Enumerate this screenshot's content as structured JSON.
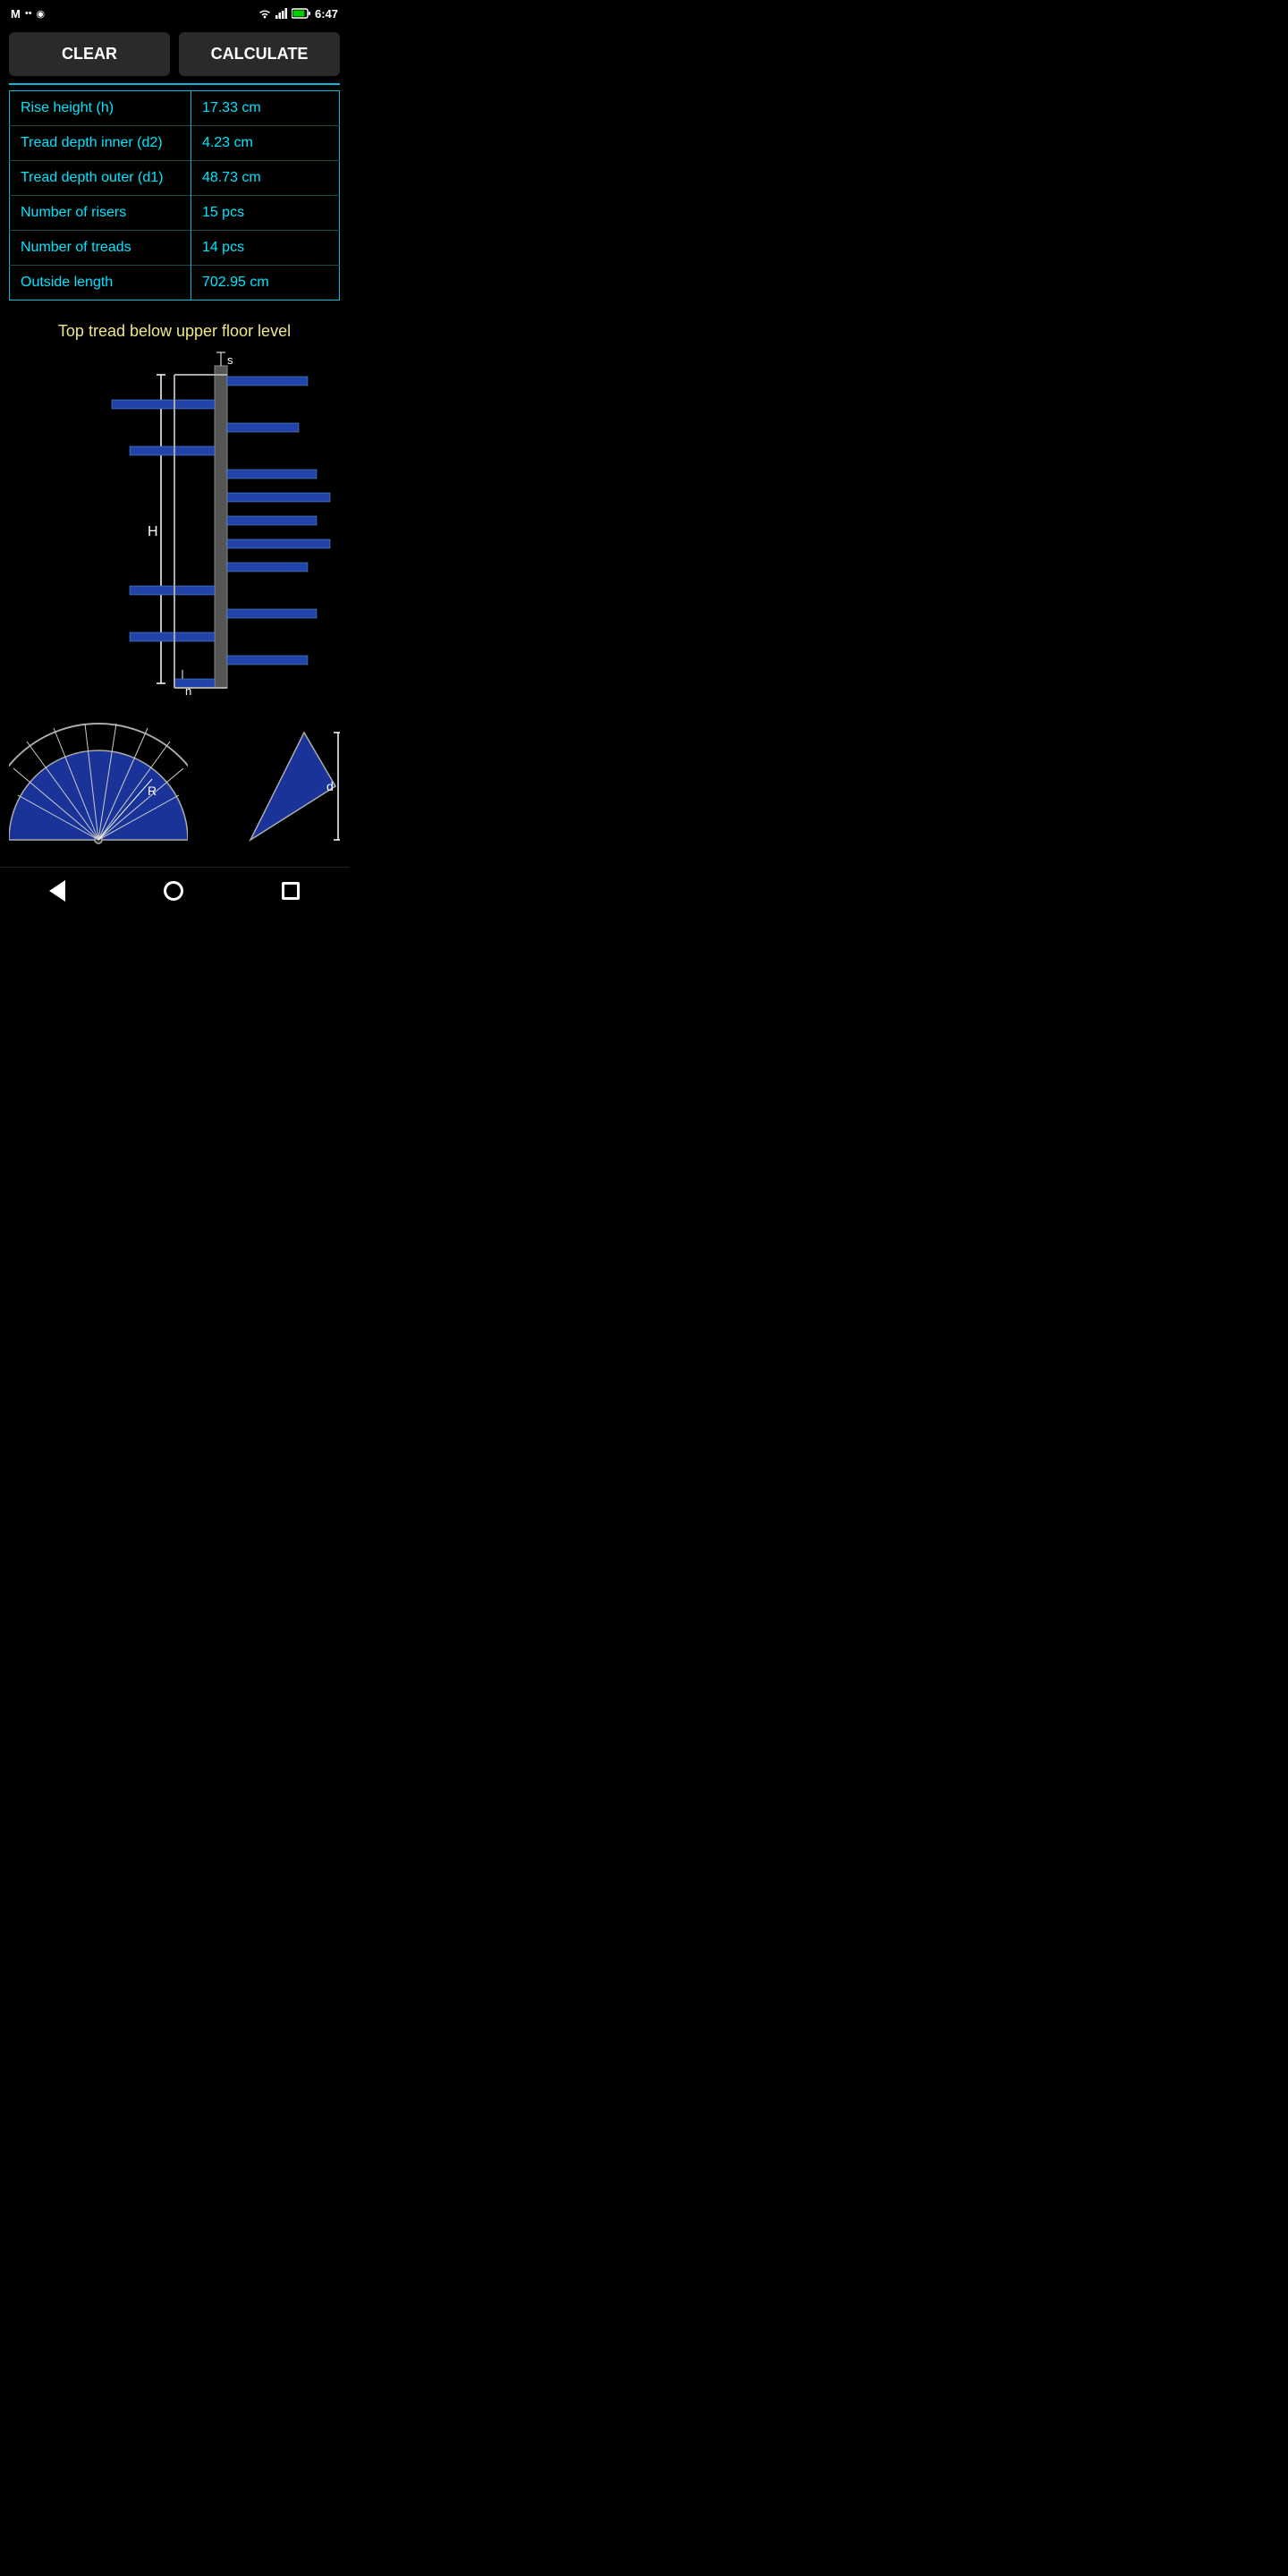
{
  "statusBar": {
    "time": "6:47",
    "icons": {
      "gmail": "M",
      "dots": "••",
      "circle": "○"
    }
  },
  "buttons": {
    "clear": "CLEAR",
    "calculate": "CALCULATE"
  },
  "results": [
    {
      "label": "Rise height (h)",
      "value": "17.33 cm"
    },
    {
      "label": "Tread depth inner (d2)",
      "value": "4.23 cm"
    },
    {
      "label": "Tread depth outer (d1)",
      "value": "48.73 cm"
    },
    {
      "label": "Number of risers",
      "value": "15 pcs"
    },
    {
      "label": "Number of treads",
      "value": "14 pcs"
    },
    {
      "label": "Outside length",
      "value": "702.95 cm"
    }
  ],
  "description": "Top tread below upper floor level",
  "diagram": {
    "labelH": "H",
    "labelS": "s",
    "labelh": "h",
    "labelR": "R",
    "labeld": "d"
  },
  "nav": {
    "back": "back",
    "home": "home",
    "recent": "recent"
  }
}
